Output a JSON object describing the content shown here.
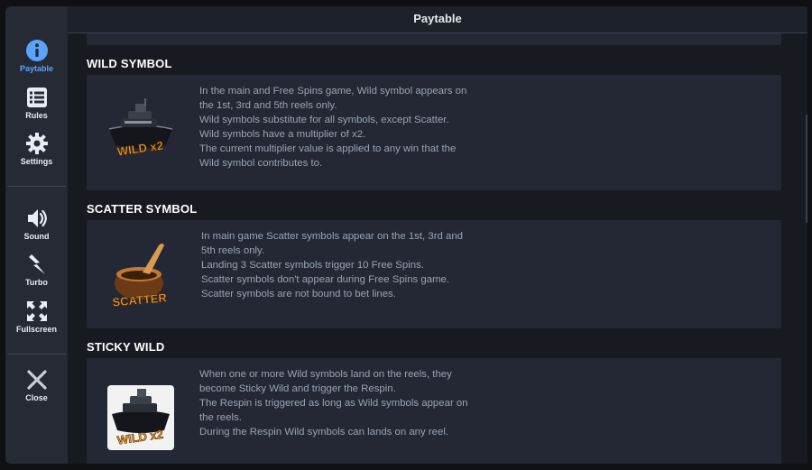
{
  "header": {
    "title": "Paytable"
  },
  "sidebar": {
    "items": [
      {
        "label": "Paytable",
        "icon": "info-icon",
        "active": true
      },
      {
        "label": "Rules",
        "icon": "list-icon"
      },
      {
        "label": "Settings",
        "icon": "gear-icon"
      },
      {
        "label": "Sound",
        "icon": "speaker-icon"
      },
      {
        "label": "Turbo",
        "icon": "lightning-icon"
      },
      {
        "label": "Fullscreen",
        "icon": "fullscreen-icon"
      },
      {
        "label": "Close",
        "icon": "close-icon"
      }
    ]
  },
  "sections": {
    "wild": {
      "title": "WILD SYMBOL",
      "symbol_label": "WILD x2",
      "text": "In the main and Free Spins game, Wild symbol appears on\nthe 1st, 3rd and 5th reels only.\nWild symbols substitute for all symbols, except Scatter.\nWild symbols have a multiplier of x2.\nThe current multiplier value is applied to any win that the\nWild symbol contributes to."
    },
    "scatter": {
      "title": "SCATTER SYMBOL",
      "symbol_label": "SCATTER",
      "text": "In main game Scatter symbols appear on the 1st, 3rd and\n5th reels only.\nLanding 3 Scatter symbols trigger 10 Free Spins.\nScatter symbols don't appear during Free Spins game.\nScatter symbols are not bound to bet lines."
    },
    "sticky": {
      "title": "STICKY WILD",
      "symbol_label": "WILD x2",
      "text": "When one or more Wild symbols land on the reels, they\nbecome Sticky Wild and trigger the Respin.\nThe Respin is triggered as long as Wild symbols appear on\nthe reels.\nDuring the Respin Wild symbols can lands on any reel."
    }
  },
  "colors": {
    "accent": "#5aa3ff",
    "gold": "#f0a020",
    "panel": "#232834"
  }
}
